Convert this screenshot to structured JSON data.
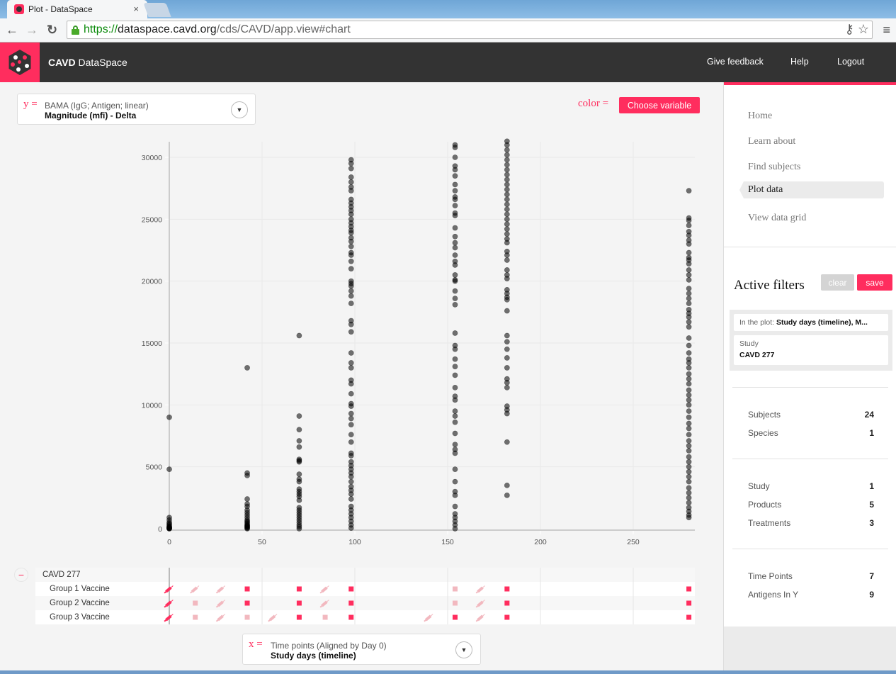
{
  "browser": {
    "tab_title": "Plot - DataSpace",
    "tab_close": "×",
    "url_scheme": "https://",
    "url_host": "dataspace.cavd.org",
    "url_path": "/cds/CAVD/app.view#chart",
    "back_icon": "←",
    "forward_icon": "→",
    "reload_icon": "↻",
    "key_icon": "⚷",
    "star_icon": "☆",
    "menu_icon": "≡"
  },
  "header": {
    "brand_bold": "CAVD",
    "brand_rest": " DataSpace",
    "links": [
      "Give feedback",
      "Help",
      "Logout"
    ]
  },
  "y_selector": {
    "eq": "y =",
    "line1": "BAMA (IgG; Antigen; linear)",
    "line2": "Magnitude (mfi) - Delta",
    "dropdown_icon": "▼"
  },
  "color_selector": {
    "label": "color =",
    "button": "Choose variable"
  },
  "x_selector": {
    "eq": "x =",
    "line1": "Time points (Aligned by Day 0)",
    "line2": "Study days (timeline)",
    "dropdown_icon": "▼"
  },
  "chart_data": {
    "type": "scatter",
    "title": "",
    "xlabel": "Study days (timeline)",
    "ylabel": "Magnitude (mfi) - Delta",
    "xlim": [
      0,
      285
    ],
    "ylim": [
      0,
      31500
    ],
    "xticks": [
      0,
      50,
      100,
      150,
      200,
      250
    ],
    "yticks": [
      0,
      5000,
      10000,
      15000,
      20000,
      25000,
      30000
    ],
    "grid": true,
    "point_color": "#000000",
    "series": [
      {
        "x": 0,
        "y": [
          9000,
          4800,
          900,
          700,
          500,
          400,
          300,
          200,
          150,
          100,
          80,
          50,
          30,
          10,
          0
        ]
      },
      {
        "x": 42,
        "y": [
          13000,
          4500,
          4300,
          2400,
          2000,
          1800,
          1500,
          1300,
          1100,
          900,
          700,
          600,
          500,
          400,
          300,
          250,
          200,
          150,
          100,
          50,
          0
        ]
      },
      {
        "x": 70,
        "y": [
          15600,
          9100,
          8000,
          7100,
          6600,
          5600,
          5500,
          5400,
          4400,
          4000,
          3800,
          3200,
          3000,
          2800,
          2600,
          2300,
          1700,
          1500,
          1300,
          1100,
          900,
          700,
          500,
          300,
          150,
          0
        ]
      },
      {
        "x": 98,
        "y": [
          29800,
          29500,
          29100,
          28400,
          28000,
          27600,
          27300,
          26600,
          26300,
          26000,
          25700,
          25400,
          25000,
          24700,
          24400,
          24100,
          23900,
          23500,
          23200,
          22800,
          22300,
          22100,
          21600,
          21000,
          20000,
          19800,
          19600,
          19200,
          18800,
          18200,
          16800,
          16500,
          15900,
          14200,
          13400,
          13000,
          12000,
          11700,
          10900,
          10100,
          9900,
          9300,
          8900,
          8400,
          7600,
          7000,
          6100,
          5900,
          5400,
          5100,
          4800,
          4500,
          4200,
          3800,
          3400,
          3100,
          2800,
          2400,
          1800,
          1500,
          1200,
          900,
          600,
          300,
          50
        ]
      },
      {
        "x": 154,
        "y": [
          31000,
          30800,
          30000,
          29300,
          29000,
          28500,
          27800,
          27300,
          26800,
          26600,
          26100,
          25500,
          25300,
          24300,
          23600,
          23100,
          22700,
          22100,
          21600,
          21300,
          20500,
          20100,
          20000,
          19200,
          18600,
          18100,
          15800,
          14800,
          14500,
          13700,
          13100,
          12400,
          11400,
          10700,
          10400,
          9500,
          9100,
          8600,
          7700,
          6800,
          6400,
          6100,
          4800,
          3800,
          3000,
          2700,
          1800,
          1200,
          900,
          600,
          300,
          0
        ]
      },
      {
        "x": 182,
        "y": [
          31300,
          31000,
          30600,
          30200,
          29800,
          29400,
          29000,
          28600,
          28200,
          27800,
          27400,
          27000,
          26600,
          26200,
          25800,
          25400,
          25000,
          24600,
          24200,
          23800,
          23400,
          23100,
          22400,
          22100,
          21700,
          20900,
          20500,
          20200,
          19300,
          19000,
          18700,
          18500,
          17600,
          15600,
          15100,
          14500,
          13800,
          13000,
          12100,
          11800,
          11400,
          9900,
          9600,
          9300,
          7000,
          3500,
          2700
        ]
      },
      {
        "x": 280,
        "y": [
          27300,
          25100,
          24900,
          24500,
          24000,
          23700,
          23300,
          23000,
          22300,
          21900,
          21700,
          21400,
          20900,
          20500,
          20100,
          19400,
          19000,
          18600,
          18200,
          17700,
          17400,
          17100,
          16700,
          16300,
          15400,
          14800,
          14200,
          13700,
          13400,
          13000,
          12500,
          12100,
          11700,
          11200,
          10800,
          10400,
          10000,
          9500,
          9000,
          8500,
          8100,
          7600,
          7100,
          6700,
          6300,
          5800,
          5400,
          5000,
          4600,
          4200,
          3800,
          3300,
          2900,
          2500,
          2100,
          1700,
          1400,
          1100,
          900
        ]
      }
    ]
  },
  "timeline": {
    "collapse_icon": "−",
    "study": "CAVD 277",
    "groups": [
      {
        "label": "Group 1 Vaccine",
        "events": [
          {
            "day": 0,
            "kind": "vaccination",
            "state": "active"
          },
          {
            "day": 14,
            "kind": "vaccination",
            "state": "inactive"
          },
          {
            "day": 28,
            "kind": "vaccination",
            "state": "inactive"
          },
          {
            "day": 42,
            "kind": "sample",
            "state": "active"
          },
          {
            "day": 70,
            "kind": "sample",
            "state": "active"
          },
          {
            "day": 84,
            "kind": "vaccination",
            "state": "inactive"
          },
          {
            "day": 98,
            "kind": "sample",
            "state": "active"
          },
          {
            "day": 154,
            "kind": "sample",
            "state": "inactive"
          },
          {
            "day": 168,
            "kind": "vaccination",
            "state": "inactive"
          },
          {
            "day": 182,
            "kind": "sample",
            "state": "active"
          },
          {
            "day": 280,
            "kind": "sample",
            "state": "active"
          }
        ]
      },
      {
        "label": "Group 2 Vaccine",
        "events": [
          {
            "day": 0,
            "kind": "vaccination",
            "state": "active"
          },
          {
            "day": 14,
            "kind": "sample",
            "state": "inactive"
          },
          {
            "day": 28,
            "kind": "vaccination",
            "state": "inactive"
          },
          {
            "day": 42,
            "kind": "sample",
            "state": "active"
          },
          {
            "day": 70,
            "kind": "sample",
            "state": "active"
          },
          {
            "day": 84,
            "kind": "vaccination",
            "state": "inactive"
          },
          {
            "day": 98,
            "kind": "sample",
            "state": "active"
          },
          {
            "day": 154,
            "kind": "sample",
            "state": "inactive"
          },
          {
            "day": 168,
            "kind": "vaccination",
            "state": "inactive"
          },
          {
            "day": 182,
            "kind": "sample",
            "state": "active"
          },
          {
            "day": 280,
            "kind": "sample",
            "state": "active"
          }
        ]
      },
      {
        "label": "Group 3 Vaccine",
        "events": [
          {
            "day": 0,
            "kind": "vaccination",
            "state": "active"
          },
          {
            "day": 14,
            "kind": "sample",
            "state": "inactive"
          },
          {
            "day": 28,
            "kind": "vaccination",
            "state": "inactive"
          },
          {
            "day": 42,
            "kind": "sample",
            "state": "inactive"
          },
          {
            "day": 56,
            "kind": "vaccination",
            "state": "inactive"
          },
          {
            "day": 70,
            "kind": "sample",
            "state": "active"
          },
          {
            "day": 84,
            "kind": "sample",
            "state": "inactive"
          },
          {
            "day": 98,
            "kind": "sample",
            "state": "active"
          },
          {
            "day": 140,
            "kind": "vaccination",
            "state": "inactive"
          },
          {
            "day": 154,
            "kind": "sample",
            "state": "active"
          },
          {
            "day": 168,
            "kind": "vaccination",
            "state": "inactive"
          },
          {
            "day": 182,
            "kind": "sample",
            "state": "active"
          },
          {
            "day": 280,
            "kind": "sample",
            "state": "active"
          }
        ]
      }
    ],
    "colors": {
      "active": "#ff2d5e",
      "inactive": "#f2b8bf"
    }
  },
  "sidebar": {
    "nav": [
      "Home",
      "Learn about",
      "Find subjects",
      "Plot data",
      "View data grid"
    ],
    "active_nav": "Plot data",
    "active_filters_title": "Active filters",
    "clear_label": "clear",
    "save_label": "save",
    "in_plot_key": "In the plot:",
    "in_plot_value": "Study days (timeline), M...",
    "study_key": "Study",
    "study_value": "CAVD 277",
    "stats": [
      [
        {
          "label": "Subjects",
          "value": "24"
        },
        {
          "label": "Species",
          "value": "1"
        }
      ],
      [
        {
          "label": "Study",
          "value": "1"
        },
        {
          "label": "Products",
          "value": "5"
        },
        {
          "label": "Treatments",
          "value": "3"
        }
      ],
      [
        {
          "label": "Time Points",
          "value": "7"
        },
        {
          "label": "Antigens In Y",
          "value": "9"
        }
      ]
    ]
  },
  "accent_color": "#ff2d5e"
}
